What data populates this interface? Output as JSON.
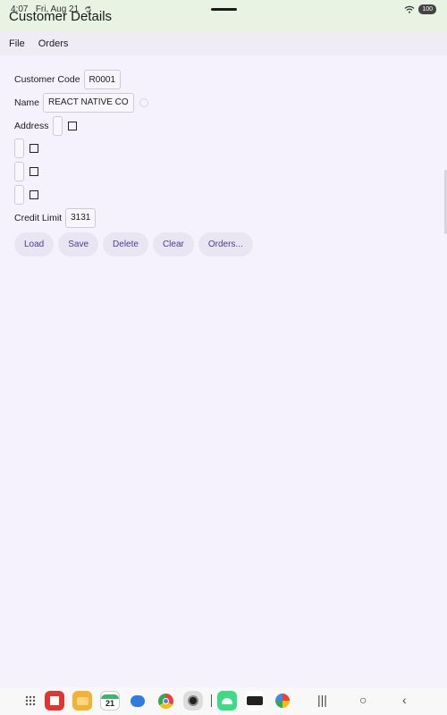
{
  "status_bar": {
    "time": "4:07",
    "date": "Fri, Aug 21",
    "battery": "100"
  },
  "app": {
    "title": "Customer Details"
  },
  "menu": {
    "items": [
      "File",
      "Orders"
    ]
  },
  "form": {
    "customer_code_label": "Customer Code",
    "customer_code_value": "R0001",
    "name_label": "Name",
    "name_value": "REACT NATIVE CO",
    "address_label": "Address",
    "credit_limit_label": "Credit Limit",
    "credit_limit_value": "3131"
  },
  "buttons": {
    "load": "Load",
    "save": "Save",
    "delete": "Delete",
    "clear": "Clear",
    "orders": "Orders..."
  },
  "taskbar": {
    "calendar_day": "21",
    "apps": [
      "app-drawer-icon",
      "flipboard-icon",
      "folder-icon",
      "calendar-icon",
      "messages-icon",
      "chrome-icon",
      "camera-icon",
      "android-studio-icon",
      "mobile-cobol-icon",
      "photos-icon"
    ]
  }
}
